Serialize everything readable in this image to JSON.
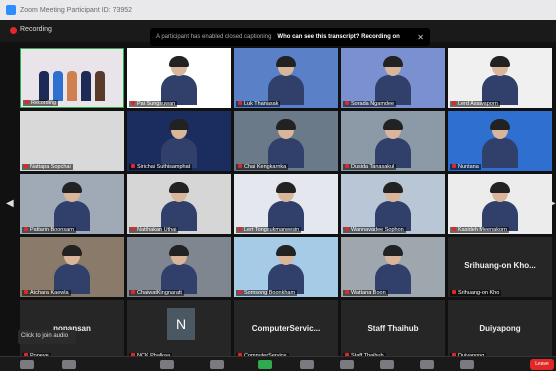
{
  "window": {
    "title": "Zoom Meeting Participant ID: 73952"
  },
  "topbar": {
    "recording_label": "Recording"
  },
  "banner": {
    "left_text": "A participant has enabled closed captioning",
    "right_text": "Who can see this transcript? Recording on"
  },
  "tiles": [
    {
      "name": "Recording",
      "bg": "#e9e4e9",
      "type": "banner"
    },
    {
      "name": "Pai Sungsuwan",
      "bg": "#ffffff",
      "type": "person"
    },
    {
      "name": "Luk Thanasak",
      "bg": "#5a80c8",
      "type": "person"
    },
    {
      "name": "Sorada Ngamdee",
      "bg": "#7a90d0",
      "type": "person"
    },
    {
      "name": "Lerd Asawaporn",
      "bg": "#f0f0f0",
      "type": "person"
    },
    {
      "name": "Nattapa Sopchai",
      "bg": "#d9d9d9",
      "type": "empty"
    },
    {
      "name": "Sirichai Suthisamphat",
      "bg": "#1b2d5e",
      "type": "person"
    },
    {
      "name": "Chai Kengkarnka",
      "bg": "#6a7a88",
      "type": "person"
    },
    {
      "name": "Dusida Tanasakul",
      "bg": "#8c9aa8",
      "type": "person"
    },
    {
      "name": "Nuntana",
      "bg": "#2f6fd0",
      "type": "person"
    },
    {
      "name": "Pattarin Boonsarn",
      "bg": "#a0aab6",
      "type": "person"
    },
    {
      "name": "Natthakan Uthai",
      "bg": "#d6d6d6",
      "type": "person"
    },
    {
      "name": "Lert Tongsukmaneesin",
      "bg": "#e4e8ee",
      "type": "person"
    },
    {
      "name": "Wannavadee Sophon",
      "bg": "#b9c6d6",
      "type": "person"
    },
    {
      "name": "Kasideh Meenakorn",
      "bg": "#ececec",
      "type": "person"
    },
    {
      "name": "Atchara Kaewla",
      "bg": "#8a7a6a",
      "type": "person"
    },
    {
      "name": "ChaiwatKingnaratt",
      "bg": "#7f8690",
      "type": "person"
    },
    {
      "name": "Somsong Boonkham",
      "bg": "#a6cbe6",
      "type": "person"
    },
    {
      "name": "Wattana Boon",
      "bg": "#9ea6ae",
      "type": "person"
    },
    {
      "name": "Srihuang-on Kho",
      "bg": "#262626",
      "type": "text",
      "big": "Srihuang-on Kho..."
    },
    {
      "name": "Popeye",
      "bg": "#262626",
      "type": "text",
      "big": "nopansan"
    },
    {
      "name": "NCK Phalkaa",
      "bg": "#262626",
      "type": "avatar",
      "letter": "N"
    },
    {
      "name": "ComputerService",
      "bg": "#262626",
      "type": "text",
      "big": "ComputerServic..."
    },
    {
      "name": "Staff Thaihub",
      "bg": "#262626",
      "type": "text",
      "big": "Staff Thaihub"
    },
    {
      "name": "Duiyapong",
      "bg": "#262626",
      "type": "text",
      "big": "Duiyapong"
    }
  ],
  "tooltip": {
    "text": "Click to join audio"
  },
  "footer": {
    "leave_label": "Leave"
  },
  "colors": {
    "accent": "#2d8cff",
    "danger": "#e02828"
  }
}
